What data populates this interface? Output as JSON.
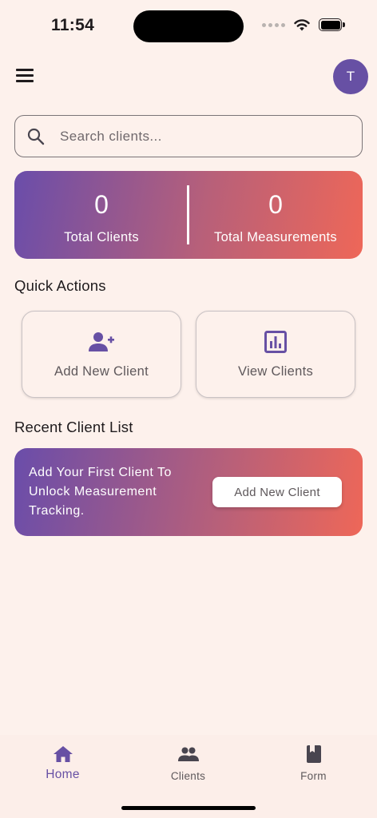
{
  "status_bar": {
    "time": "11:54"
  },
  "header": {
    "avatar_initial": "T"
  },
  "search": {
    "placeholder": "Search clients...",
    "value": ""
  },
  "stats": {
    "total_clients_value": "0",
    "total_clients_label": "Total Clients",
    "total_measurements_value": "0",
    "total_measurements_label": "Total Measurements"
  },
  "quick_actions": {
    "title": "Quick Actions",
    "add_client_label": "Add New Client",
    "view_clients_label": "View Clients"
  },
  "recent": {
    "title": "Recent Client List",
    "banner_text": "Add Your First Client To Unlock Measurement Tracking.",
    "banner_button_label": "Add New Client"
  },
  "bottom_nav": {
    "home_label": "Home",
    "clients_label": "Clients",
    "form_label": "Form"
  },
  "colors": {
    "primary": "#6750A4",
    "background": "#FDF1EC",
    "gradient_start": "#6A4DAA",
    "gradient_end": "#EE6758"
  },
  "icons": [
    "menu-icon",
    "search-icon",
    "person-add-icon",
    "bar-chart-icon",
    "home-icon",
    "group-icon",
    "book-icon",
    "wifi-icon",
    "battery-icon",
    "signal-icon"
  ]
}
